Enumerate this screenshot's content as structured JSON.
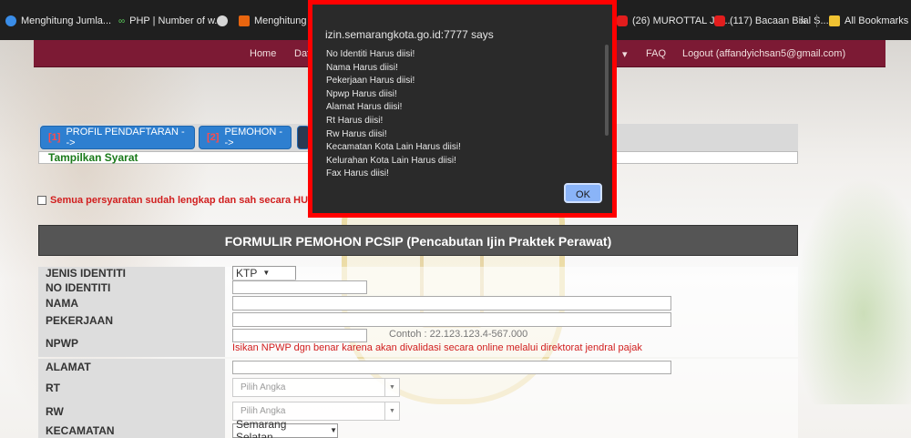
{
  "bookmarks": [
    {
      "label": "Menghitung Jumla...",
      "icon": "blue-circle-icon"
    },
    {
      "label": "PHP | Number of w...",
      "icon": "green-link-icon"
    },
    {
      "label": "",
      "icon": "globe-icon"
    },
    {
      "label": "Menghitung Ju",
      "icon": "orange-square-icon"
    },
    {
      "label": "(26) MUROTTAL JU...",
      "icon": "youtube-icon"
    },
    {
      "label": "(117) Bacaan Bilal S...",
      "icon": "youtube-icon"
    },
    {
      "label": "All Bookmarks",
      "icon": "folder-icon"
    }
  ],
  "bookmarks_overflow": "»",
  "nav": {
    "home": "Home",
    "daftar": "Daf",
    "faq": "FAQ",
    "logout": "Logout (affandyichsan5@gmail.com)",
    "caret": "▾"
  },
  "tabs": [
    {
      "num": "[1]",
      "label": "PROFIL PENDAFTARAN -->"
    },
    {
      "num": "[2]",
      "label": "PEMOHON -->"
    }
  ],
  "syarat": "Tampilkan Syarat",
  "agree_text": "Semua persyaratan sudah lengkap dan sah secara HUKUM",
  "form": {
    "title": "FORMULIR PEMOHON PCSIP (Pencabutan Ijin Praktek Perawat)",
    "labels": {
      "jenis": "JENIS IDENTITI",
      "no": "NO IDENTITI",
      "nama": "NAMA",
      "pekerjaan": "PEKERJAAN",
      "npwp": "NPWP",
      "alamat": "ALAMAT",
      "rt": "RT",
      "rw": "RW",
      "kecamatan": "KECAMATAN"
    },
    "jenis_value": "KTP",
    "npwp_hint": "Contoh : 22.123.123.4-567.000",
    "npwp_warning": "Isikan NPWP dgn benar karena akan divalidasi secara online melalui direktorat jendral pajak",
    "rt_placeholder": "Pilih Angka",
    "rw_placeholder": "Pilih Angka",
    "kecamatan_value": "Semarang Selatan"
  },
  "dialog": {
    "title": "izin.semarangkota.go.id:7777 says",
    "messages": [
      "No Identiti Harus diisi!",
      "Nama Harus diisi!",
      "Pekerjaan Harus diisi!",
      "Npwp Harus diisi!",
      "Alamat Harus diisi!",
      "Rt Harus diisi!",
      "Rw Harus diisi!",
      "Kecamatan Kota Lain Harus diisi!",
      "Kelurahan Kota Lain Harus diisi!",
      "Fax Harus diisi!"
    ],
    "ok": "OK"
  },
  "colors": {
    "navbar": "#7c1a34",
    "tab": "#2e7fd0",
    "alert_border": "#ff0000",
    "ok_button": "#8ab4f8",
    "warning": "#d11e1e",
    "syarat": "#1a7a1a"
  }
}
